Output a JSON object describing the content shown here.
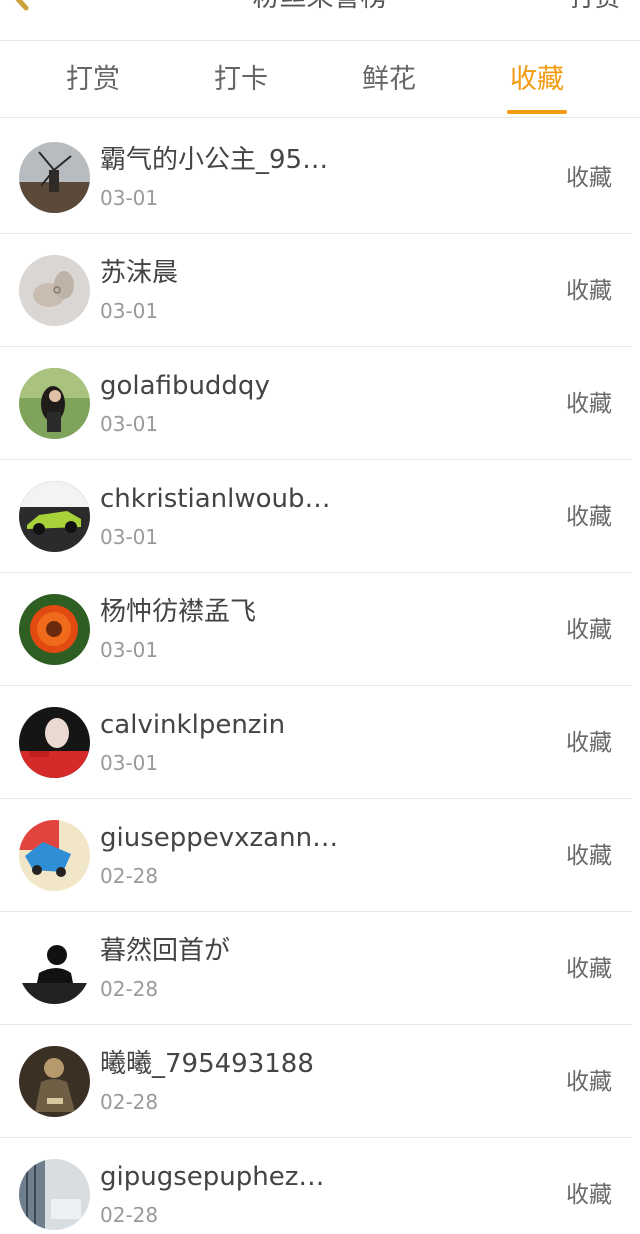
{
  "navbar": {
    "title": "粉丝荣誉榜",
    "action_label": "打赏"
  },
  "tabs": [
    {
      "label": "打赏",
      "active": false
    },
    {
      "label": "打卡",
      "active": false
    },
    {
      "label": "鲜花",
      "active": false
    },
    {
      "label": "收藏",
      "active": true
    }
  ],
  "colors": {
    "accent": "#f39c12",
    "text": "#444444",
    "subtext": "#9a9a9a",
    "divider": "#e6e6e6"
  },
  "list": [
    {
      "name": "霸气的小公主_95…",
      "date": "03-01",
      "action": "收藏",
      "avatar": "windmill-avatar"
    },
    {
      "name": "苏沫晨",
      "date": "03-01",
      "action": "收藏",
      "avatar": "hands-avatar"
    },
    {
      "name": "golafibuddqy",
      "date": "03-01",
      "action": "收藏",
      "avatar": "woman-avatar"
    },
    {
      "name": "chkristianlwoub…",
      "date": "03-01",
      "action": "收藏",
      "avatar": "car-avatar"
    },
    {
      "name": "杨忡彷襟孟飞",
      "date": "03-01",
      "action": "收藏",
      "avatar": "flower-avatar"
    },
    {
      "name": "calvinklpenzin",
      "date": "03-01",
      "action": "收藏",
      "avatar": "portrait-avatar"
    },
    {
      "name": "giuseppevxzann…",
      "date": "02-28",
      "action": "收藏",
      "avatar": "toy-car-avatar"
    },
    {
      "name": "暮然回首が",
      "date": "02-28",
      "action": "收藏",
      "avatar": "silhouette-avatar"
    },
    {
      "name": "曦曦_795493188",
      "date": "02-28",
      "action": "收藏",
      "avatar": "soldier-avatar"
    },
    {
      "name": "gipugsepuphez…",
      "date": "02-28",
      "action": "收藏",
      "avatar": "window-avatar"
    }
  ]
}
